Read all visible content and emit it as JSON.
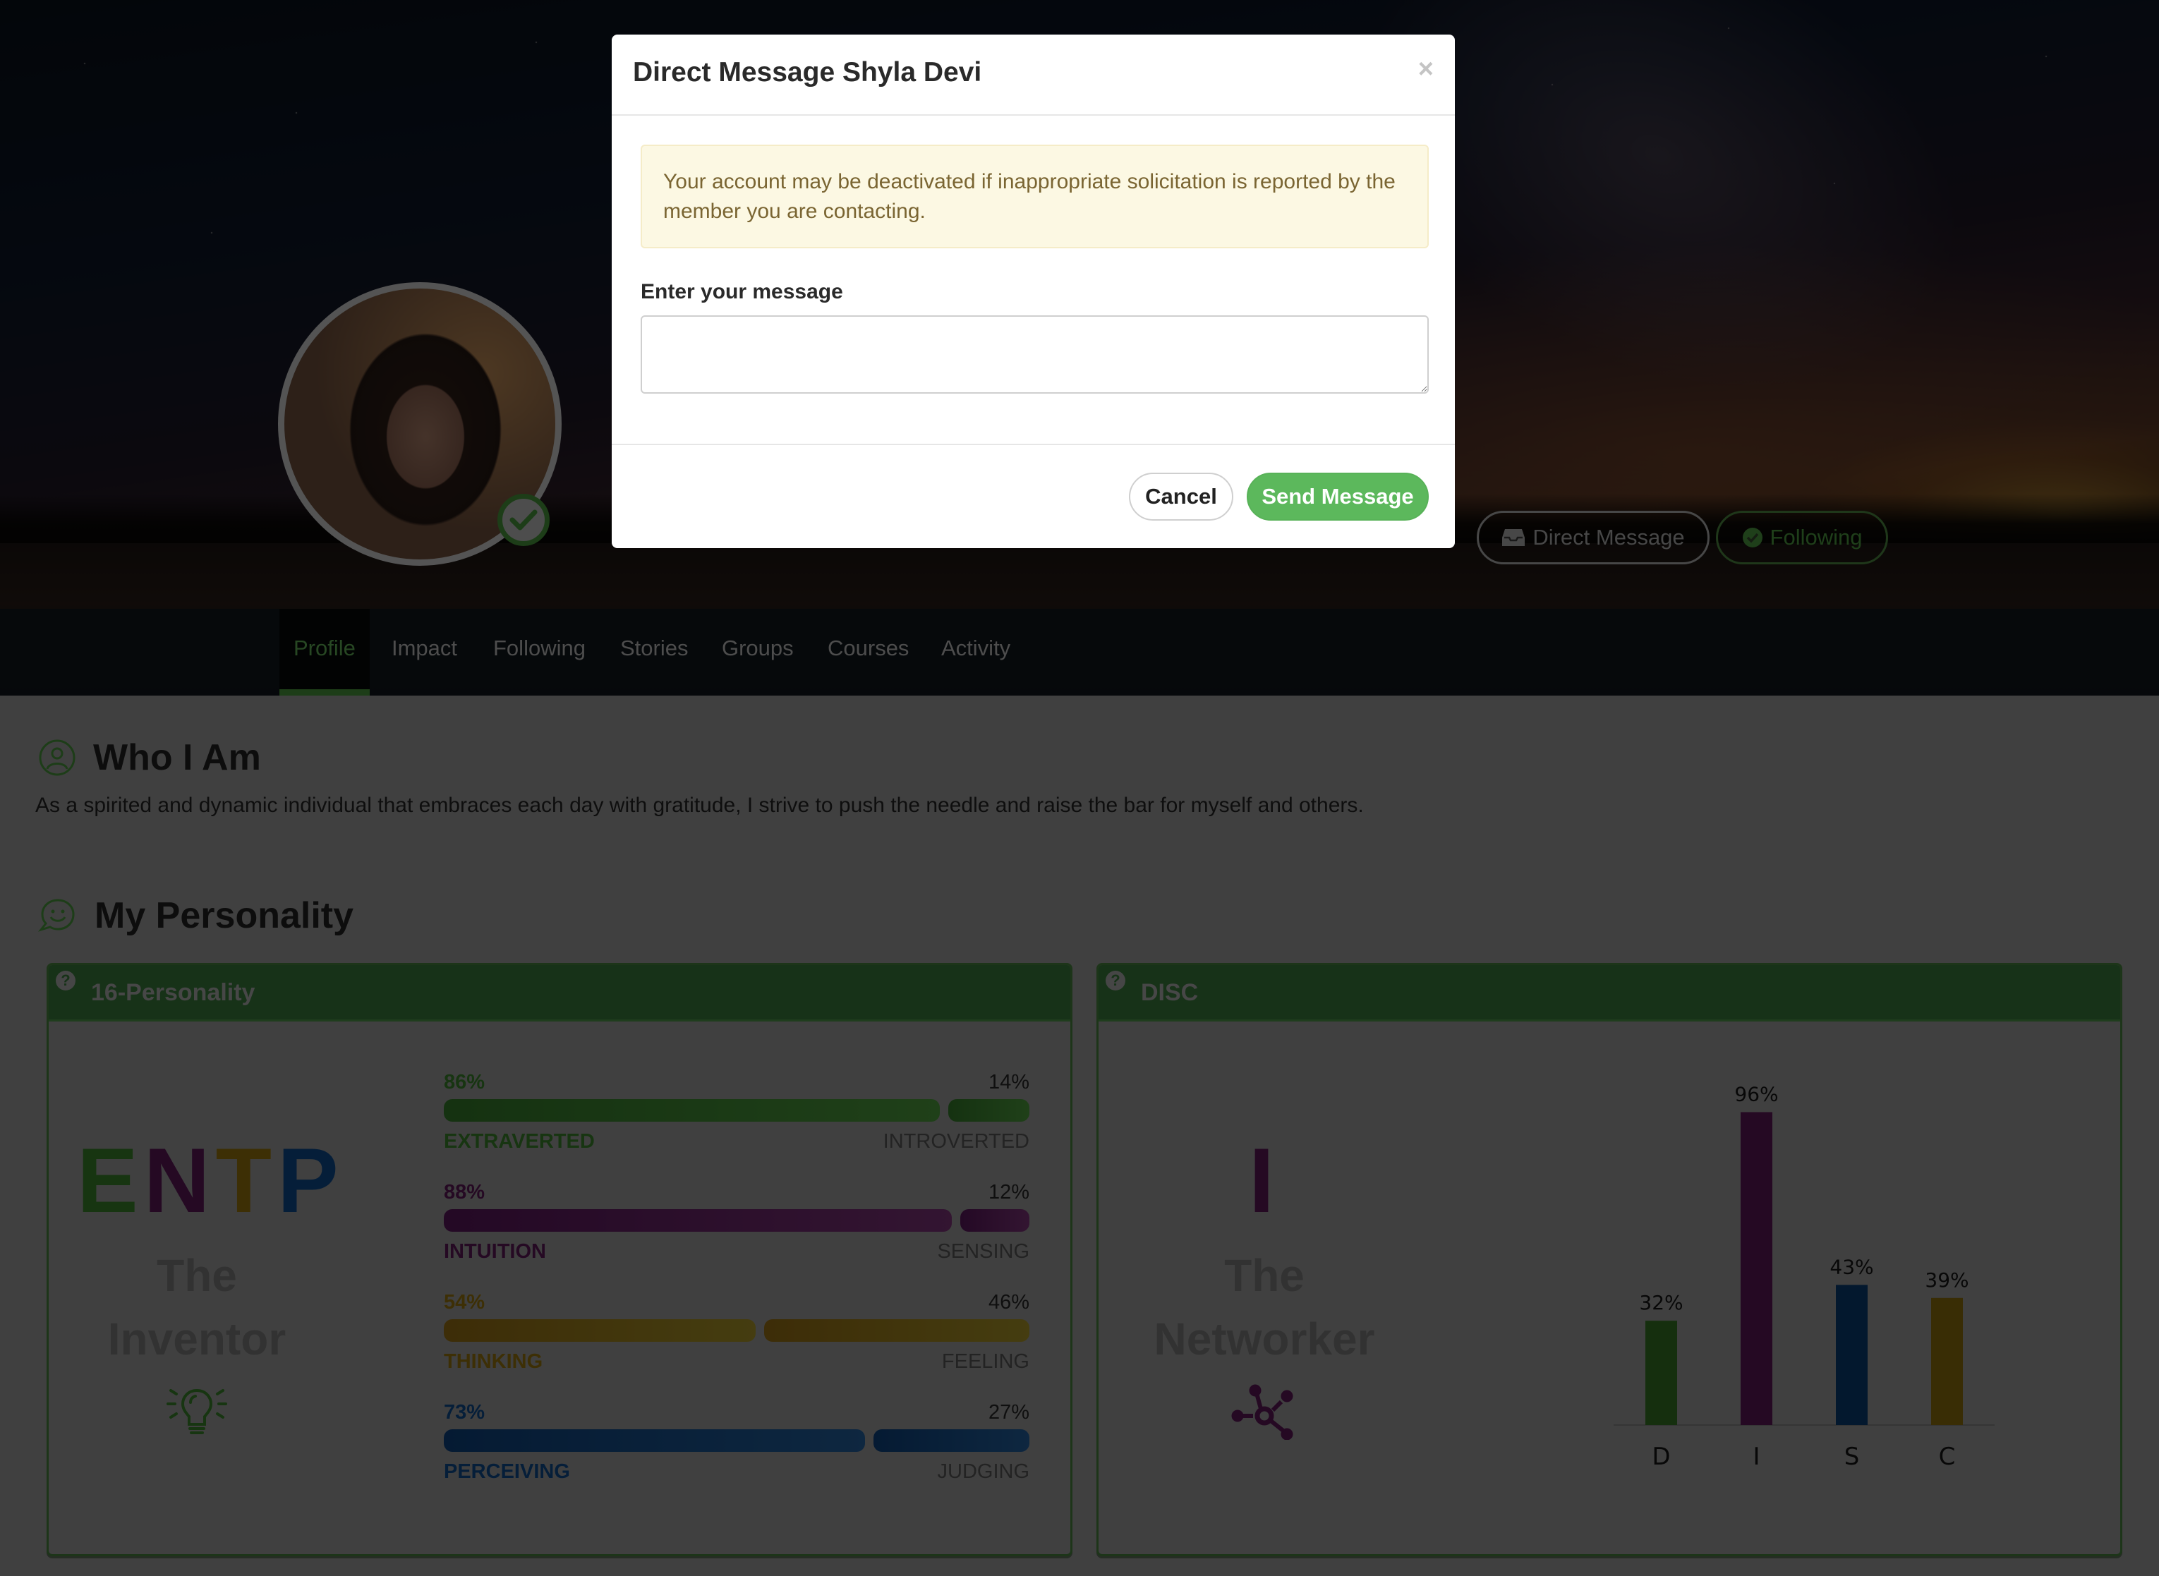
{
  "hero": {
    "direct_message_label": "Direct Message",
    "following_label": "Following",
    "verified": true
  },
  "nav": {
    "tabs": [
      {
        "label": "Profile",
        "active": true
      },
      {
        "label": "Impact",
        "active": false
      },
      {
        "label": "Following",
        "active": false
      },
      {
        "label": "Stories",
        "active": false
      },
      {
        "label": "Groups",
        "active": false
      },
      {
        "label": "Courses",
        "active": false
      },
      {
        "label": "Activity",
        "active": false
      }
    ]
  },
  "about": {
    "title": "Who I Am",
    "text": "As a spirited and dynamic individual that embraces each day with gratitude, I strive to push the needle and raise the bar for myself and others."
  },
  "personality": {
    "title": "My Personality",
    "sixteen": {
      "title": "16-Personality",
      "help": "?",
      "letters": [
        {
          "char": "E",
          "color": "#2e6b23"
        },
        {
          "char": "N",
          "color": "#4a1247"
        },
        {
          "char": "T",
          "color": "#7a5f0a"
        },
        {
          "char": "P",
          "color": "#0b3c73"
        }
      ],
      "type_name_line1": "The",
      "type_name_line2": "Inventor",
      "icon": "lightbulb-icon",
      "traits": [
        {
          "left_label": "EXTRAVERTED",
          "left_pct": 86,
          "left_text": "86%",
          "right_label": "INTROVERTED",
          "right_pct": 14,
          "right_text": "14%",
          "color": "#2e6b23",
          "grad_from": "#2a6422",
          "grad_to": "#3f8032"
        },
        {
          "left_label": "INTUITION",
          "left_pct": 88,
          "left_text": "88%",
          "right_label": "SENSING",
          "right_pct": 12,
          "right_text": "12%",
          "color": "#4a1247",
          "grad_from": "#48124a",
          "grad_to": "#662a63"
        },
        {
          "left_label": "THINKING",
          "left_pct": 54,
          "left_text": "54%",
          "right_label": "FEELING",
          "right_pct": 46,
          "right_text": "46%",
          "color": "#7a5f0a",
          "grad_from": "#7a5a10",
          "grad_to": "#8a7a20"
        },
        {
          "left_label": "PERCEIVING",
          "left_pct": 73,
          "left_text": "73%",
          "right_label": "JUDGING",
          "right_pct": 27,
          "right_text": "27%",
          "color": "#0b3c73",
          "grad_from": "#0a3566",
          "grad_to": "#1c4e80"
        }
      ]
    },
    "disc": {
      "title": "DISC",
      "help": "?",
      "letter": "I",
      "letter_color": "#4a1247",
      "type_name_line1": "The",
      "type_name_line2": "Networker",
      "icon": "network-icon"
    }
  },
  "chart_data": {
    "type": "bar",
    "title": "DISC",
    "categories": [
      "D",
      "I",
      "S",
      "C"
    ],
    "values": [
      32,
      96,
      43,
      39
    ],
    "value_labels": [
      "32%",
      "96%",
      "43%",
      "39%"
    ],
    "colors": [
      "#2a5e1c",
      "#4a1247",
      "#06305c",
      "#735a0b"
    ],
    "ylim": [
      0,
      100
    ],
    "grid": false,
    "xlabel": "",
    "ylabel": ""
  },
  "dialog": {
    "title": "Direct Message Shyla Devi",
    "close_symbol": "×",
    "warning": "Your account may be deactivated if inappropriate solicitation is reported by the member you are contacting.",
    "message_label": "Enter your message",
    "message_value": "",
    "message_placeholder": "",
    "cancel_label": "Cancel",
    "send_label": "Send Message"
  },
  "colors": {
    "accent_green": "#5cb85c",
    "card_header_green": "#2e6431",
    "overlay": "rgba(0,0,0,0.5)"
  }
}
